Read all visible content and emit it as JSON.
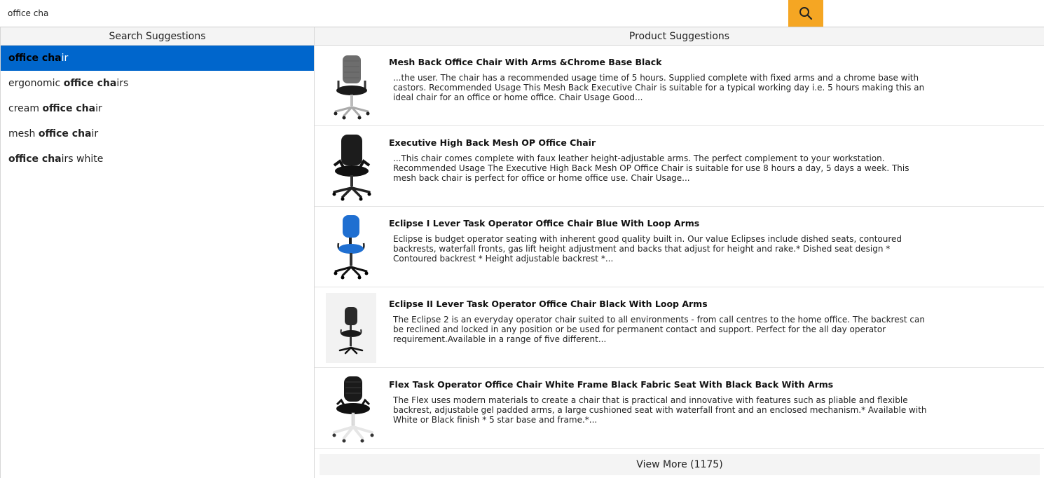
{
  "search": {
    "value": "office cha"
  },
  "left_panel": {
    "header": "Search Suggestions",
    "items": [
      {
        "text_before": "",
        "match": "office cha",
        "text_after": "ir",
        "active": true
      },
      {
        "text_before": "ergonomic ",
        "match": "office cha",
        "text_after": "irs",
        "active": false
      },
      {
        "text_before": "cream ",
        "match": "office cha",
        "text_after": "ir",
        "active": false
      },
      {
        "text_before": "mesh ",
        "match": "office cha",
        "text_after": "ir",
        "active": false
      },
      {
        "text_before": "",
        "match": "office cha",
        "text_after": "irs white",
        "active": false
      }
    ]
  },
  "right_panel": {
    "header": "Product Suggestions",
    "products": [
      {
        "title": "Mesh Back Office Chair With Arms &Chrome Base Black",
        "description": "...the user. The chair has a recommended usage time of 5 hours. Supplied complete with fixed arms and a chrome base with castors. Recommended Usage This Mesh Back Executive Chair is suitable for a typical working day i.e. 5 hours making this an ideal chair for an office or home office. Chair Usage Good...",
        "thumb": "mesh-grey-chair"
      },
      {
        "title": "Executive High Back Mesh OP Office Chair",
        "description": "...This chair comes complete with faux leather height-adjustable arms. The perfect complement to your workstation. Recommended Usage The Executive High Back Mesh OP Office Chair is suitable for use 8 hours a day, 5 days a week. This mesh back chair is perfect for office or home office use. Chair Usage...",
        "thumb": "black-mesh-chair"
      },
      {
        "title": "Eclipse I Lever Task Operator Office Chair Blue With Loop Arms",
        "description": "Eclipse is budget operator seating with inherent good quality built in. Our value Eclipses include dished seats, contoured backrests, waterfall fronts, gas lift height adjustment and backs that adjust for height and rake.* Dished seat design * Contoured backrest * Height adjustable backrest *...",
        "thumb": "blue-task-chair"
      },
      {
        "title": "Eclipse II Lever Task Operator Office Chair Black With Loop Arms",
        "description": "The Eclipse 2 is an everyday operator chair suited to all environments - from call centres to the home office. The backrest can be reclined and locked in any position or be used for permanent contact and support. Perfect for the all day operator requirement.Available in a range of five different...",
        "thumb": "black-task-chair"
      },
      {
        "title": "Flex Task Operator Office Chair White Frame Black Fabric Seat With Black Back With Arms",
        "description": "The Flex uses modern materials to create a chair that is practical and innovative with features such as pliable and flexible backrest, adjustable gel padded arms, a large cushioned seat with waterfall front and an enclosed mechanism.* Available with White or Black finish * 5 star base and frame.*...",
        "thumb": "flex-white-chair"
      }
    ],
    "view_more": "View More (1175)"
  },
  "colors": {
    "search_button": "#f5a623",
    "active_suggestion": "#0066cc"
  },
  "icons": {
    "search_button": "search-icon"
  }
}
